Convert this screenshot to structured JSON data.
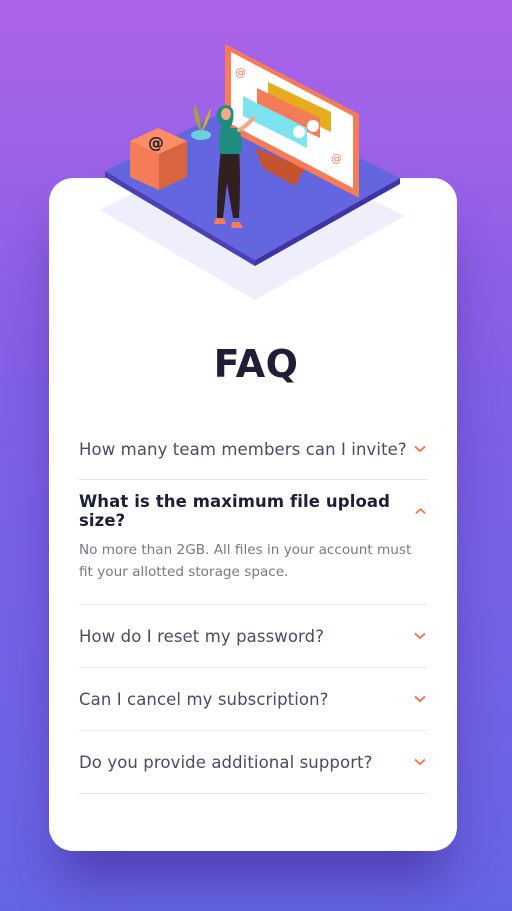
{
  "page": {
    "title": "FAQ"
  },
  "faq": {
    "items": [
      {
        "question": "How many team members can I invite?",
        "answer": "",
        "open": false
      },
      {
        "question": "What is the maximum file upload size?",
        "answer": "No more than 2GB. All files in your account must fit your allotted storage space.",
        "open": true
      },
      {
        "question": "How do I reset my password?",
        "answer": "",
        "open": false
      },
      {
        "question": "Can I cancel my subscription?",
        "answer": "",
        "open": false
      },
      {
        "question": "Do you provide additional support?",
        "answer": "",
        "open": false
      }
    ]
  },
  "colors": {
    "bg_top": "#ac62e8",
    "bg_bottom": "#6565e4",
    "heading": "#1e1f36",
    "text": "#4b4c5f",
    "answer": "#787887",
    "accent": "#f47c57",
    "divider": "#e7e7e9"
  },
  "icons": {
    "collapsed": "chevron-down-icon",
    "expanded": "chevron-up-icon"
  }
}
